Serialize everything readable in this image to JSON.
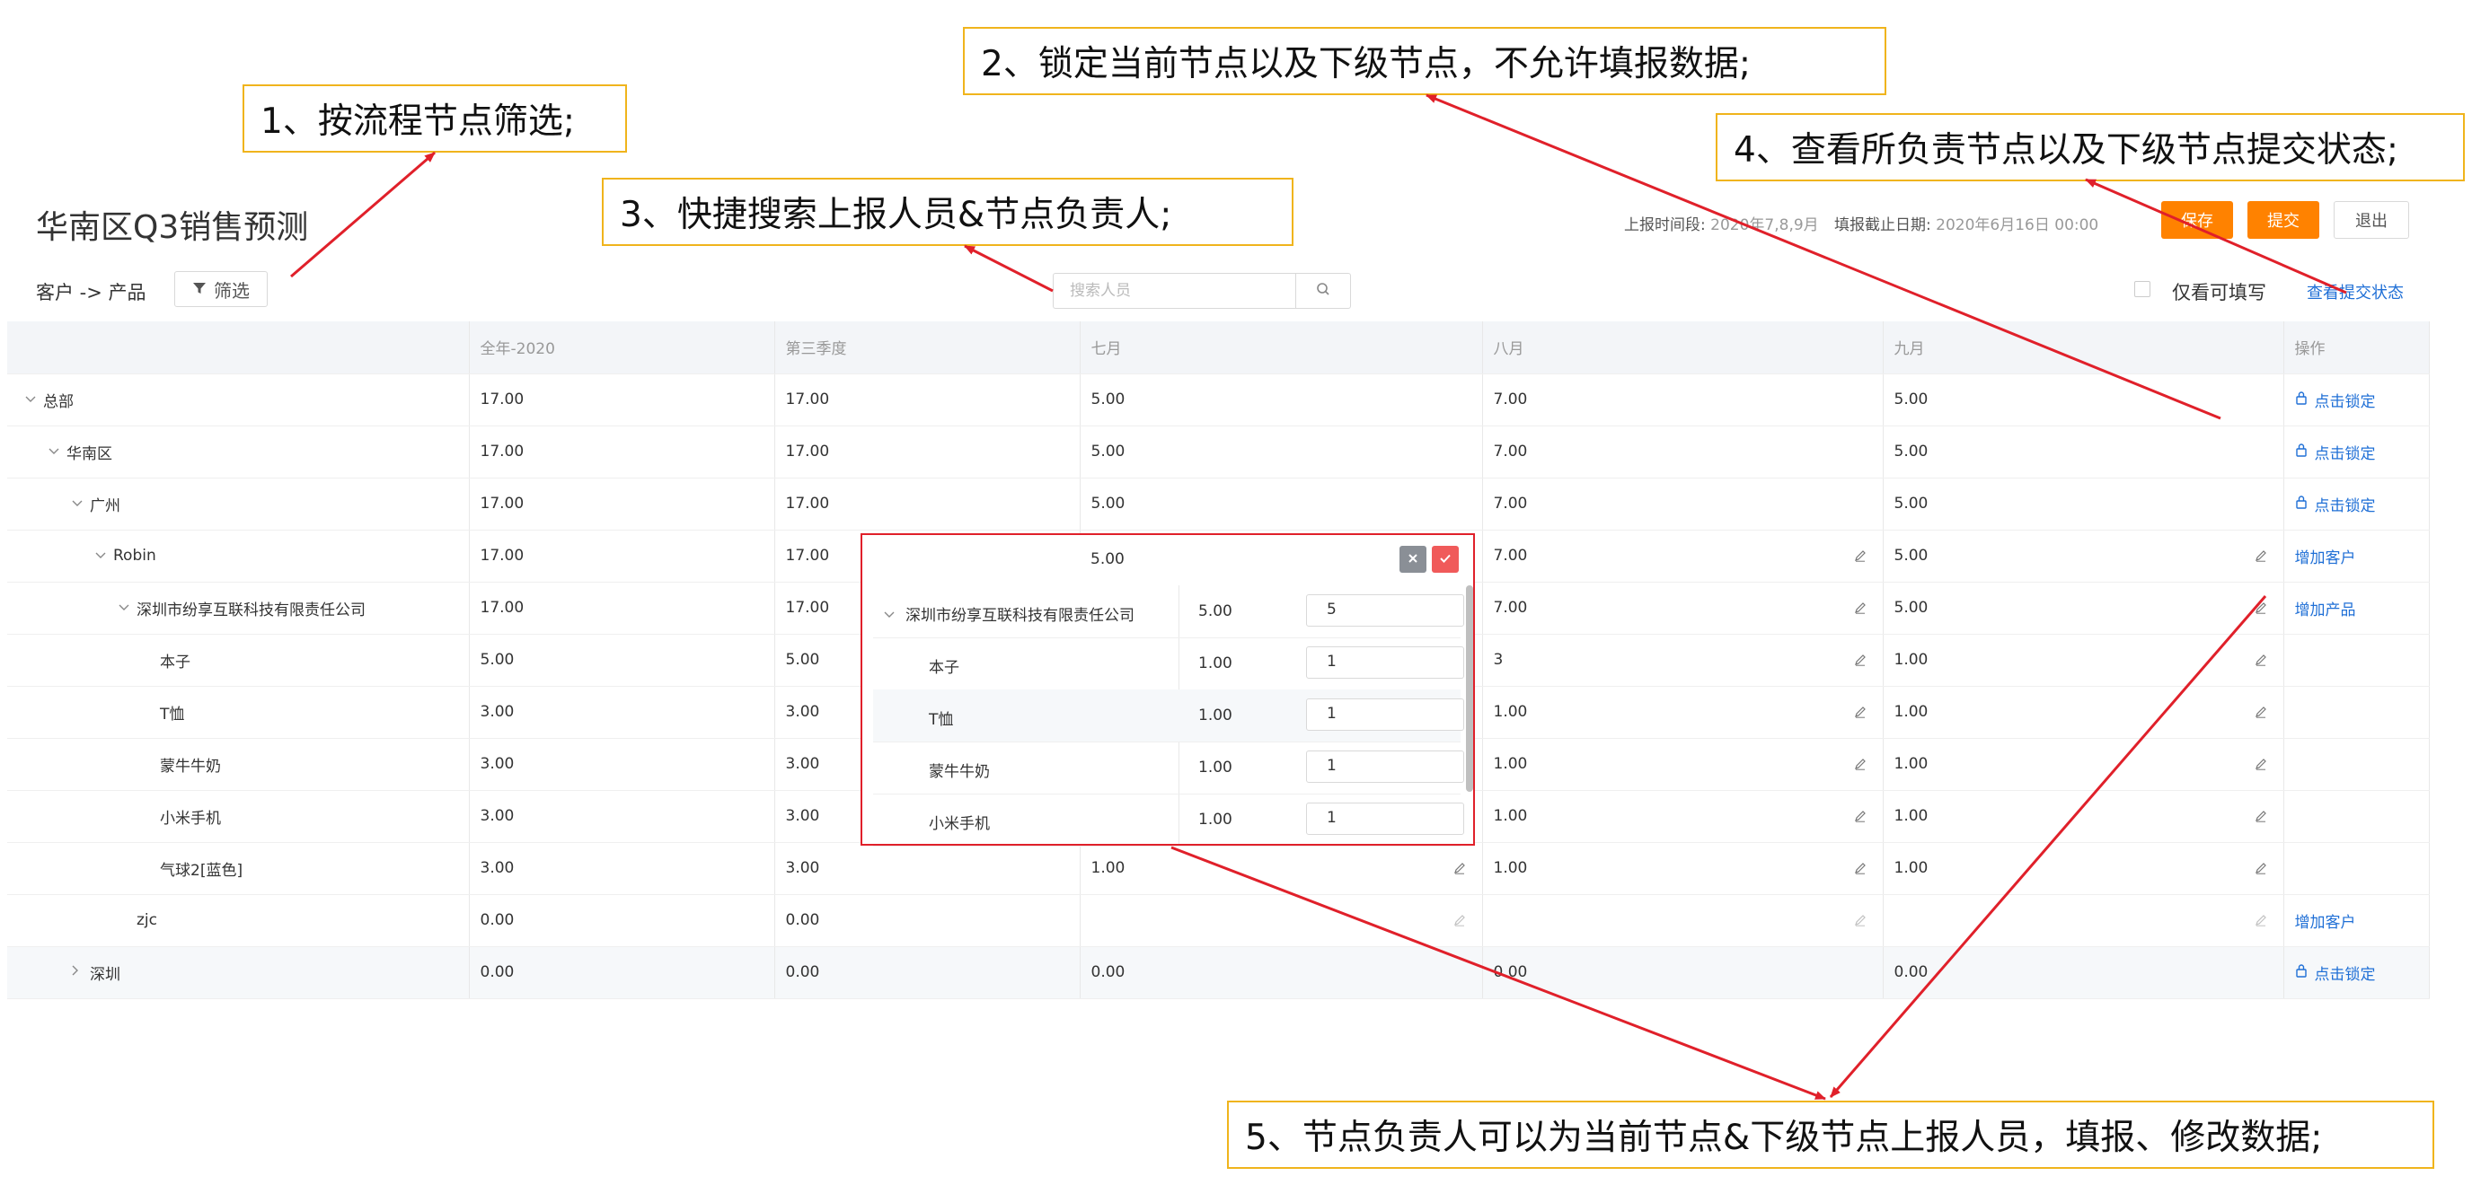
{
  "header": {
    "title": "华南区Q3销售预测",
    "report_period_label": "上报时间段:",
    "report_period_value": "2020年7,8,9月",
    "deadline_label": "填报截止日期:",
    "deadline_value": "2020年6月16日 00:00",
    "save": "保存",
    "submit": "提交",
    "exit": "退出"
  },
  "toolbar": {
    "breadcrumb": "客户 -> 产品",
    "filter": "筛选",
    "search_placeholder": "搜索人员",
    "only_writable": "仅看可填写",
    "view_status": "查看提交状态"
  },
  "table": {
    "columns": [
      "",
      "全年-2020",
      "第三季度",
      "七月",
      "八月",
      "九月",
      "操作"
    ],
    "rows": [
      {
        "name": "总部",
        "level": 0,
        "chev": "v",
        "c1": "17.00",
        "c2": "17.00",
        "c3": "5.00",
        "c4": "7.00",
        "c5": "5.00",
        "op": "点击锁定",
        "op_type": "lock"
      },
      {
        "name": "华南区",
        "level": 1,
        "chev": "v",
        "c1": "17.00",
        "c2": "17.00",
        "c3": "5.00",
        "c4": "7.00",
        "c5": "5.00",
        "op": "点击锁定",
        "op_type": "lock"
      },
      {
        "name": "广州",
        "level": 2,
        "chev": "v",
        "c1": "17.00",
        "c2": "17.00",
        "c3": "5.00",
        "c4": "7.00",
        "c5": "5.00",
        "op": "点击锁定",
        "op_type": "lock"
      },
      {
        "name": "Robin",
        "level": 3,
        "chev": "v",
        "c1": "17.00",
        "c2": "17.00",
        "c3": "5.00",
        "c4": "7.00",
        "c5": "5.00",
        "op": "增加客户",
        "op_type": "link",
        "edit": true
      },
      {
        "name": "深圳市纷享互联科技有限责任公司",
        "level": 4,
        "chev": "v",
        "c1": "17.00",
        "c2": "17.00",
        "c3": "5.00",
        "c4": "7.00",
        "c5": "5.00",
        "op": "增加产品",
        "op_type": "link",
        "edit": true
      },
      {
        "name": "本子",
        "level": 5,
        "chev": "",
        "c1": "5.00",
        "c2": "5.00",
        "c3": "",
        "c4": "3",
        "c5": "1.00",
        "op": "",
        "op_type": "",
        "edit": true
      },
      {
        "name": "T恤",
        "level": 5,
        "chev": "",
        "c1": "3.00",
        "c2": "3.00",
        "c3": "",
        "c4": "1.00",
        "c5": "1.00",
        "op": "",
        "op_type": "",
        "edit": true
      },
      {
        "name": "蒙牛牛奶",
        "level": 5,
        "chev": "",
        "c1": "3.00",
        "c2": "3.00",
        "c3": "",
        "c4": "1.00",
        "c5": "1.00",
        "op": "",
        "op_type": "",
        "edit": true
      },
      {
        "name": "小米手机",
        "level": 5,
        "chev": "",
        "c1": "3.00",
        "c2": "3.00",
        "c3": "",
        "c4": "1.00",
        "c5": "1.00",
        "op": "",
        "op_type": "",
        "edit": true
      },
      {
        "name": "气球2[蓝色]",
        "level": 5,
        "chev": "",
        "c1": "3.00",
        "c2": "3.00",
        "c3": "1.00",
        "c4": "1.00",
        "c5": "1.00",
        "op": "",
        "op_type": "",
        "edit": true,
        "edit3": true
      },
      {
        "name": "zjc",
        "level": 4,
        "chev": "",
        "c1": "0.00",
        "c2": "0.00",
        "c3": "",
        "c4": "",
        "c5": "",
        "op": "增加客户",
        "op_type": "link",
        "edit": true,
        "edit3": true,
        "faint": true
      },
      {
        "name": "深圳",
        "level": 2,
        "chev": ">",
        "c1": "0.00",
        "c2": "0.00",
        "c3": "0.00",
        "c4": "0.00",
        "c5": "0.00",
        "op": "点击锁定",
        "op_type": "lock",
        "hl": true
      }
    ]
  },
  "popup": {
    "top_value": "5.00",
    "rows": [
      {
        "name": "深圳市纷享互联科技有限责任公司",
        "chev": "v",
        "value": "5.00",
        "input": "5"
      },
      {
        "name": "本子",
        "chev": "",
        "value": "1.00",
        "input": "1"
      },
      {
        "name": "T恤",
        "chev": "",
        "value": "1.00",
        "input": "1"
      },
      {
        "name": "蒙牛牛奶",
        "chev": "",
        "value": "1.00",
        "input": "1"
      },
      {
        "name": "小米手机",
        "chev": "",
        "value": "1.00",
        "input": "1"
      }
    ]
  },
  "annotations": {
    "a1": "1、按流程节点筛选;",
    "a2": "2、锁定当前节点以及下级节点，不允许填报数据;",
    "a3": "3、快捷搜索上报人员&节点负责人;",
    "a4": "4、查看所负责节点以及下级节点提交状态;",
    "a5": "5、节点负责人可以为当前节点&下级节点上报人员，填报、修改数据;"
  },
  "colors": {
    "accent": "#ff8200",
    "link": "#1f6fd6",
    "annotation_border": "#f0b41c",
    "arrow": "#e0202a"
  }
}
